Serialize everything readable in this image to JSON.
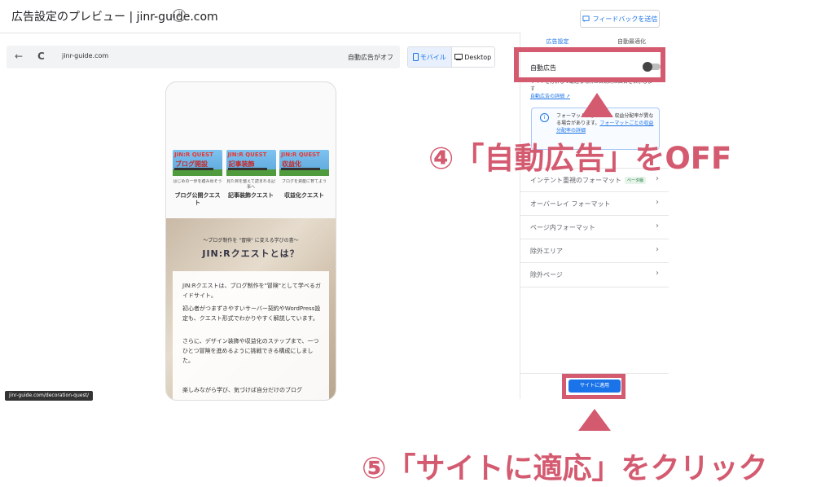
{
  "header": {
    "title": "広告設定のプレビュー | jinr-guide.com",
    "info_icon": "i",
    "feedback_button": "フィードバックを送信",
    "feedback_icon": "feedback-icon"
  },
  "toolbar": {
    "back_icon": "←",
    "reload_icon": "C",
    "url": "jinr-guide.com",
    "auto_ads_status": "自動広告がオフ",
    "device_mobile": "モバイル",
    "device_desktop": "Desktop"
  },
  "preview": {
    "cards": [
      {
        "img_top": "JIN:R QUEST",
        "img_main": "ブログ開設",
        "subtitle": "はじめの一歩を踏み出そう",
        "name": "ブログ公開クエスト"
      },
      {
        "img_top": "JIN:R QUEST",
        "img_main": "記事装飾",
        "subtitle": "見た目を整えて読まれる記事へ",
        "name": "記事装飾クエスト"
      },
      {
        "img_top": "JIN:R QUEST",
        "img_main": "収益化",
        "subtitle": "ブログを資産に育てよう",
        "name": "収益化クエスト"
      }
    ],
    "hero_tag": "〜ブログ制作を \"冒険\" に変える学びの書〜",
    "hero_heading": "JIN:Rクエストとは？",
    "paragraphs": [
      "JIN:Rクエストは、ブログ制作を\"冒険\"として学べるガイドサイト。",
      "初心者がつまずきやすいサーバー契約やWordPress設定も、クエスト形式でわかりやすく解説しています。",
      "さらに、デザイン装飾や収益化のステップまで、一つひとつ冒険を進めるように挑戦できる構成にしました。",
      "楽しみながら学び、気づけば自分だけのブログ"
    ],
    "status_url": "jinr-guide.com/decoration-quest/"
  },
  "panel": {
    "tabs": [
      "広告設定",
      "自動最適化"
    ],
    "auto_ads_label": "自動広告",
    "auto_ads_enabled": false,
    "auto_ads_desc": "サイトを分析して最適な場所に自動的に広告を表示します",
    "auto_ads_link": "自動広告の詳細",
    "note_text": "フォーマットによっては、収益分配率が異なる場合があります。",
    "note_link": "フォーマットごとの収益分配率の詳細",
    "menu": [
      {
        "label": "インテント重視のフォーマット",
        "badge": "ベータ版"
      },
      {
        "label": "オーバーレイ フォーマット",
        "badge": ""
      },
      {
        "label": "ページ内フォーマット",
        "badge": ""
      },
      {
        "label": "除外エリア",
        "badge": ""
      },
      {
        "label": "除外ページ",
        "badge": ""
      }
    ],
    "apply_button": "サイトに適用"
  },
  "annotations": {
    "step4": "④「自動広告」をOFF",
    "step5": "⑤「サイトに適応」をクリック",
    "color": "#d45a70"
  }
}
